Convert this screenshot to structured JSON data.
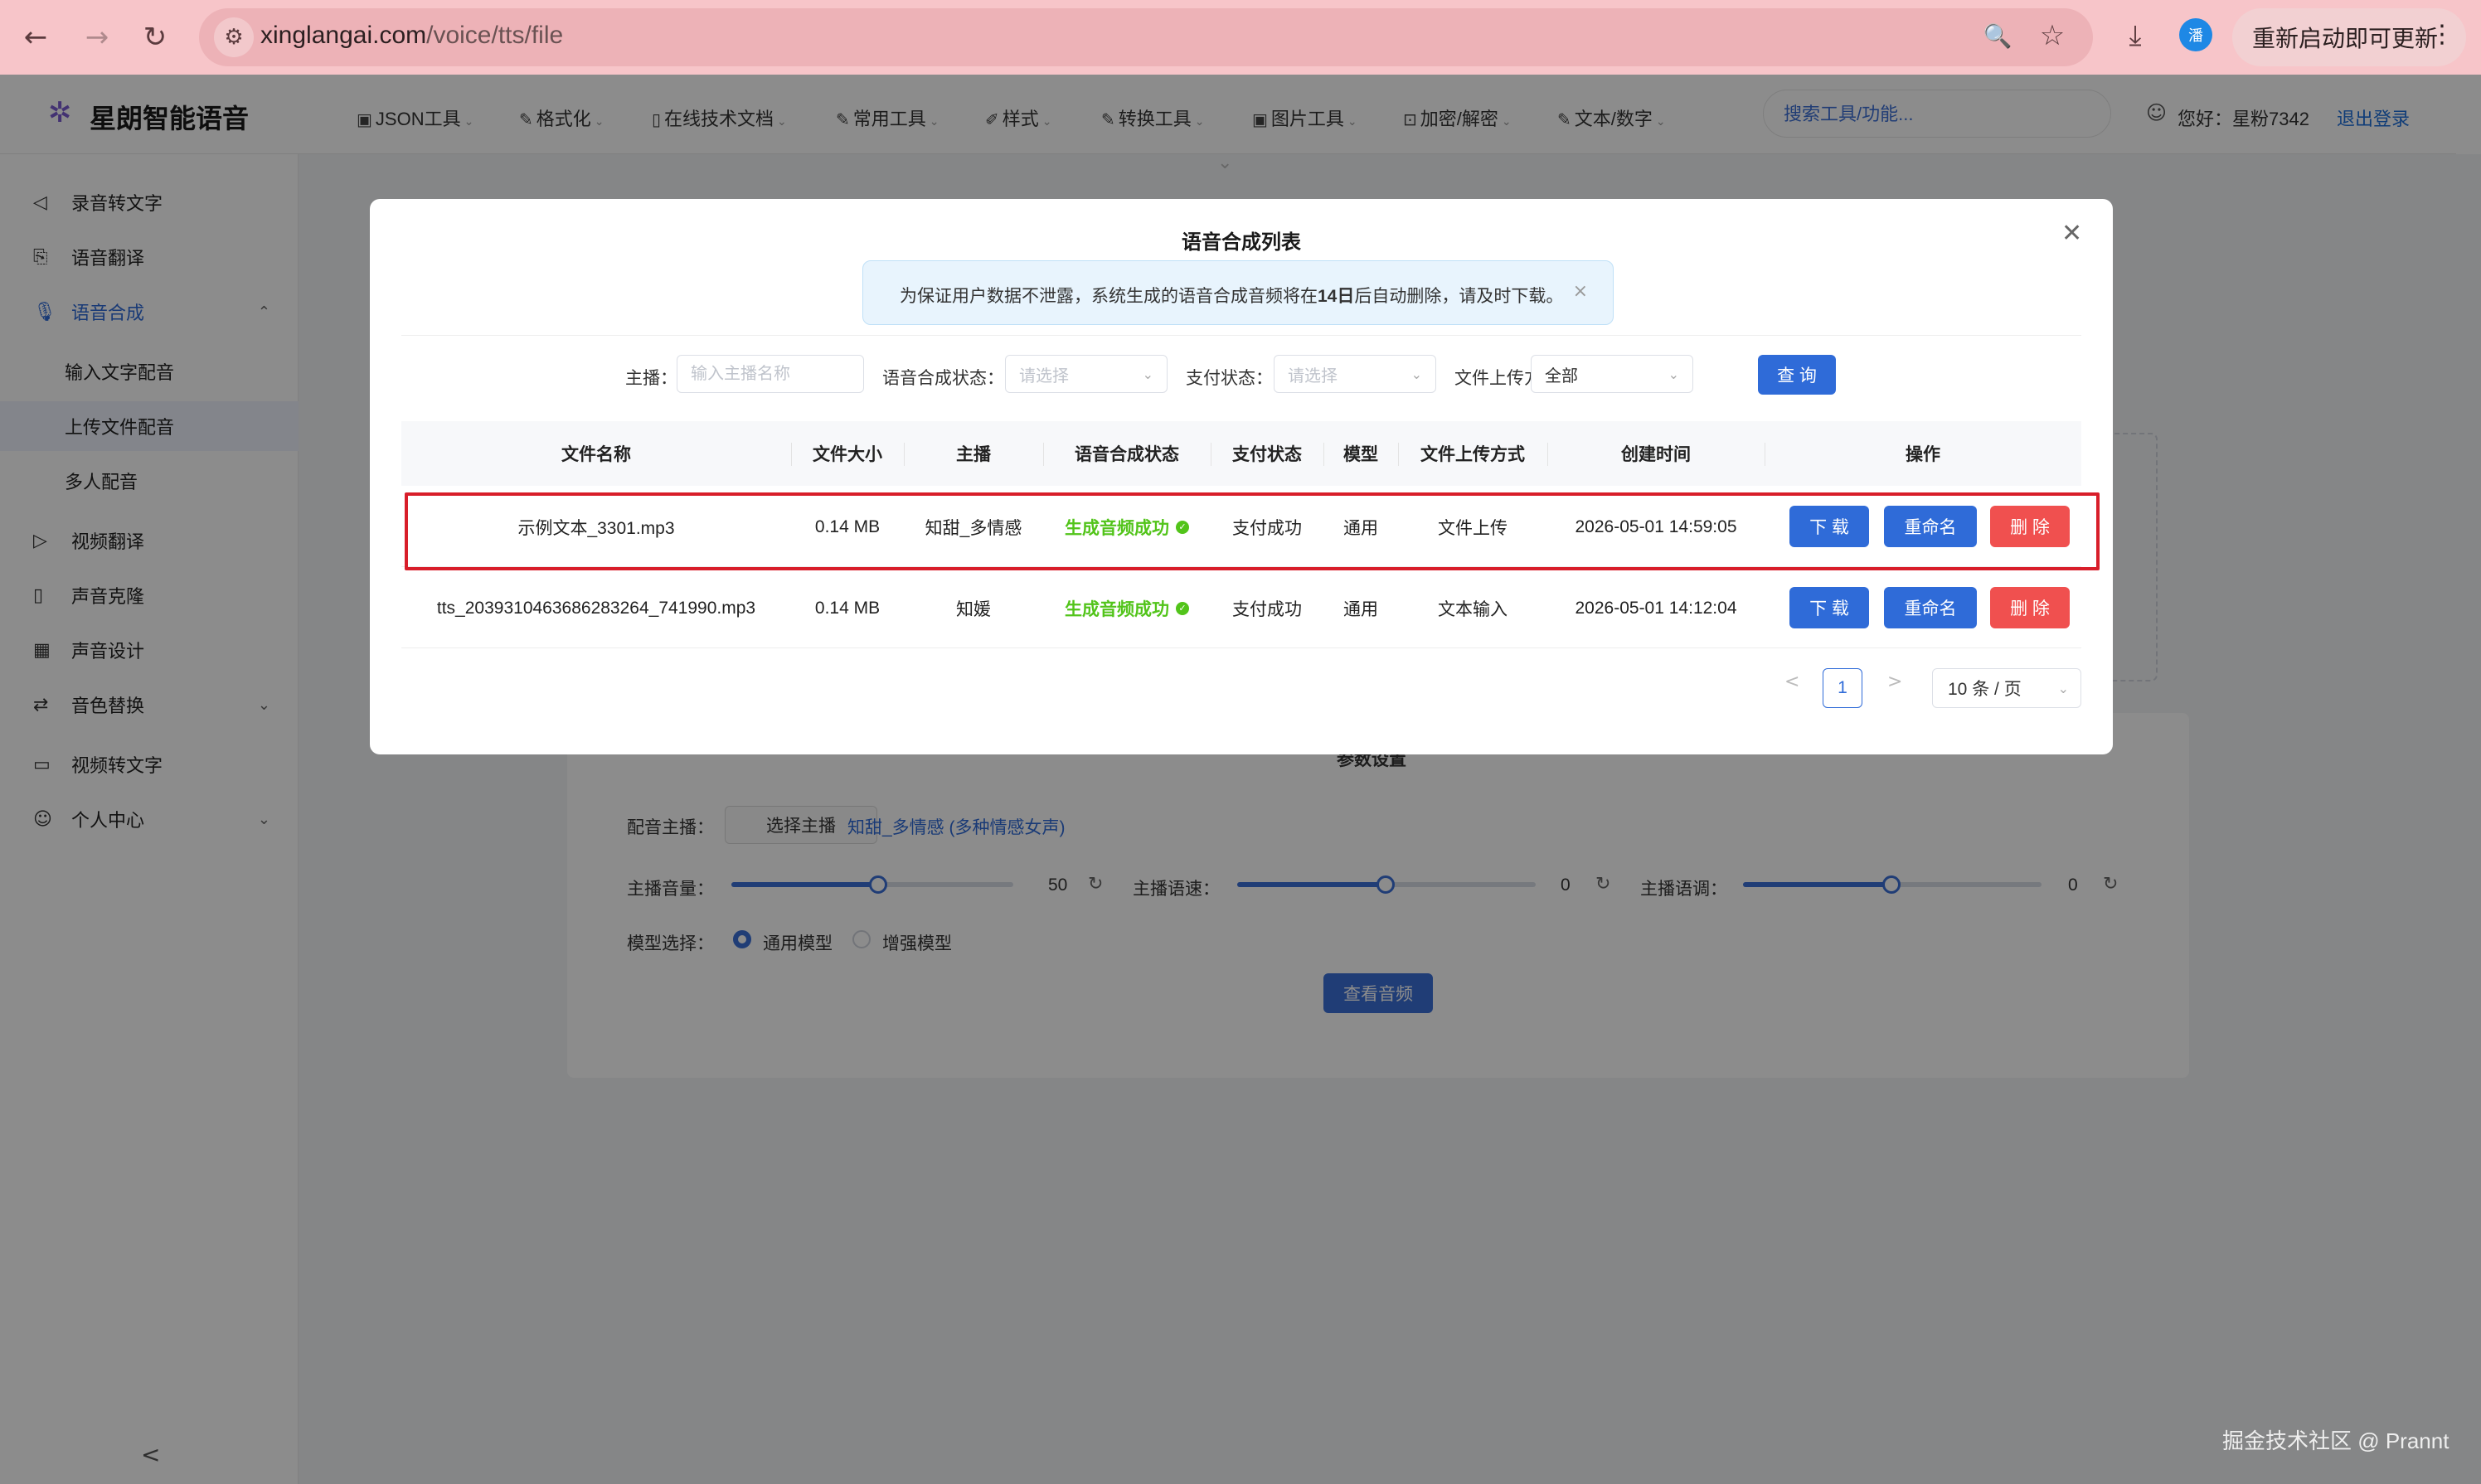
{
  "browser": {
    "url_host": "xinglangai.com",
    "url_path": "/voice/tts/file",
    "ext_badge": "潘",
    "update_label": "重新启动即可更新",
    "icons": {
      "back": "←",
      "forward": "→",
      "reload": "↻",
      "site": "⚙",
      "zoom": "🔍",
      "star": "☆",
      "download": "⤓",
      "menu": "⋮"
    }
  },
  "header": {
    "logo_icon": "✲",
    "title": "星朗智能语音",
    "nav": [
      {
        "icon": "▣",
        "label": "JSON工具"
      },
      {
        "icon": "✎",
        "label": "格式化"
      },
      {
        "icon": "▯",
        "label": "在线技术文档"
      },
      {
        "icon": "✎",
        "label": "常用工具"
      },
      {
        "icon": "✐",
        "label": "样式"
      },
      {
        "icon": "✎",
        "label": "转换工具"
      },
      {
        "icon": "▣",
        "label": "图片工具"
      },
      {
        "icon": "⊡",
        "label": "加密/解密"
      },
      {
        "icon": "✎",
        "label": "文本/数字"
      }
    ],
    "search_placeholder": "搜索工具/功能...",
    "user_greeting": "您好：星粉7342",
    "logout": "退出登录"
  },
  "sidebar": {
    "items": [
      {
        "icon": "◁",
        "label": "录音转文字"
      },
      {
        "icon": "⎘",
        "label": "语音翻译"
      },
      {
        "icon": "🎙",
        "label": "语音合成",
        "arrow": "⌃"
      },
      {
        "label": "输入文字配音"
      },
      {
        "label": "上传文件配音"
      },
      {
        "label": "多人配音"
      },
      {
        "icon": "▷",
        "label": "视频翻译"
      },
      {
        "icon": "▯",
        "label": "声音克隆"
      },
      {
        "icon": "▦",
        "label": "声音设计"
      },
      {
        "icon": "⇄",
        "label": "音色替换",
        "arrow": "⌄"
      },
      {
        "icon": "▭",
        "label": "视频转文字"
      },
      {
        "icon": "☺",
        "label": "个人中心",
        "arrow": "⌄"
      }
    ],
    "collapse_icon": "<"
  },
  "background_form": {
    "section_title": "参数设置",
    "anchor_label": "配音主播：",
    "choose_anchor": "选择主播",
    "anchor_name": "知甜_多情感 (多种情感女声)",
    "volume_label": "主播音量：",
    "volume_value": "50",
    "speed_label": "主播语速：",
    "speed_value": "0",
    "pitch_label": "主播语调：",
    "pitch_value": "0",
    "model_label": "模型选择：",
    "model_general": "通用模型",
    "model_enhanced": "增强模型",
    "view_audio": "查看音频",
    "reset_icon": "↻"
  },
  "modal": {
    "title": "语音合成列表",
    "close_icon": "✕",
    "notice_pre": "为保证用户数据不泄露，系统生成的语音合成音频将在",
    "notice_bold": "14日",
    "notice_post": "后自动删除，请及时下载。",
    "notice_close": "×",
    "filters": {
      "anchor_label": "主播：",
      "anchor_placeholder": "输入主播名称",
      "tts_status_label": "语音合成状态：",
      "tts_status_placeholder": "请选择",
      "pay_status_label": "支付状态：",
      "pay_status_placeholder": "请选择",
      "upload_label": "文件上传方式：",
      "upload_value": "全部",
      "query": "查 询",
      "dropdown_icon": "⌄"
    },
    "columns": [
      "文件名称",
      "文件大小",
      "主播",
      "语音合成状态",
      "支付状态",
      "模型",
      "文件上传方式",
      "创建时间",
      "操作"
    ],
    "rows": [
      {
        "name": "示例文本_3301.mp3",
        "size": "0.14 MB",
        "anchor": "知甜_多情感",
        "status": "生成音频成功",
        "pay": "支付成功",
        "model": "通用",
        "upload": "文件上传",
        "created": "2026-05-01 14:59:05"
      },
      {
        "name": "tts_2039310463686283264_741990.mp3",
        "size": "0.14 MB",
        "anchor": "知媛",
        "status": "生成音频成功",
        "pay": "支付成功",
        "model": "通用",
        "upload": "文本输入",
        "created": "2026-05-01 14:12:04"
      }
    ],
    "actions": {
      "download": "下 载",
      "rename": "重命名",
      "delete": "删 除"
    },
    "pagination": {
      "prev": "<",
      "next": ">",
      "current": "1",
      "page_size": "10 条 / 页"
    }
  },
  "watermark": "掘金技术社区 @ Prannt"
}
